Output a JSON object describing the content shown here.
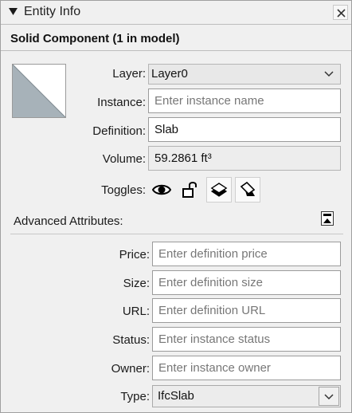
{
  "panel": {
    "title": "Entity Info",
    "header": "Solid Component (1 in model)"
  },
  "fields": {
    "layer": {
      "label": "Layer:",
      "value": "Layer0"
    },
    "instance": {
      "label": "Instance:",
      "placeholder": "Enter instance name"
    },
    "definition": {
      "label": "Definition:",
      "value": "Slab"
    },
    "volume": {
      "label": "Volume:",
      "value": "59.2861 ft³"
    },
    "toggles": {
      "label": "Toggles:"
    }
  },
  "advanced": {
    "label": "Advanced Attributes:",
    "price": {
      "label": "Price:",
      "placeholder": "Enter definition price"
    },
    "size": {
      "label": "Size:",
      "placeholder": "Enter definition size"
    },
    "url": {
      "label": "URL:",
      "placeholder": "Enter definition URL"
    },
    "status": {
      "label": "Status:",
      "placeholder": "Enter instance status"
    },
    "owner": {
      "label": "Owner:",
      "placeholder": "Enter instance owner"
    },
    "type": {
      "label": "Type:",
      "value": "IfcSlab"
    }
  },
  "icons": {
    "collapse": "triangle-down-icon",
    "close": "close-icon",
    "visibility": "eye-icon",
    "lock": "unlock-icon",
    "receive_shadows": "receive-shadows-icon",
    "cast_shadows": "cast-shadows-icon",
    "advanced_toggle": "collapse-section-icon"
  },
  "colors": {
    "thumbnail_fill": "#a7b2b9",
    "panel_bg": "#f0f0f0"
  }
}
